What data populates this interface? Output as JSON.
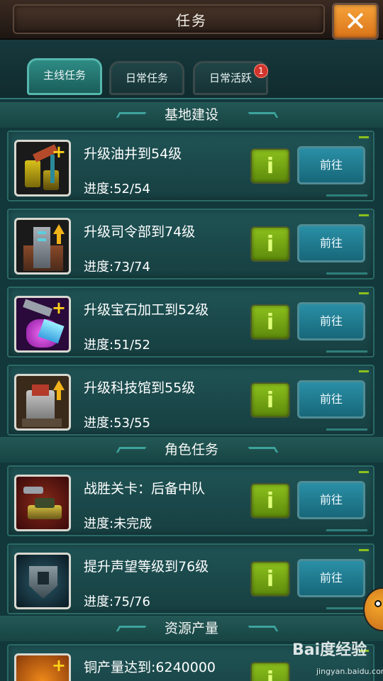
{
  "header": {
    "title": "任务",
    "close_label": "✕"
  },
  "tabs": [
    {
      "label": "主线任务",
      "active": true
    },
    {
      "label": "日常任务",
      "active": false
    },
    {
      "label": "日常活跃",
      "active": false,
      "badge": "1"
    }
  ],
  "sections": [
    {
      "title": "基地建设",
      "tasks": [
        {
          "title": "升级油井到54级",
          "progress": "进度:52/54",
          "icon": "oil-well-icon"
        },
        {
          "title": "升级司令部到74级",
          "progress": "进度:73/74",
          "icon": "headquarters-icon"
        },
        {
          "title": "升级宝石加工到52级",
          "progress": "进度:51/52",
          "icon": "gem-processing-icon"
        },
        {
          "title": "升级科技馆到55级",
          "progress": "进度:53/55",
          "icon": "tech-center-icon"
        }
      ]
    },
    {
      "title": "角色任务",
      "tasks": [
        {
          "title": "战胜关卡：后备中队",
          "progress": "进度:未完成",
          "icon": "tank-icon"
        },
        {
          "title": "提升声望等级到76级",
          "progress": "进度:75/76",
          "icon": "prestige-badge-icon"
        }
      ]
    },
    {
      "title": "资源产量",
      "tasks": [
        {
          "title": "铜产量达到:6240000",
          "progress": "",
          "icon": "copper-icon"
        }
      ]
    }
  ],
  "buttons": {
    "info_label": "i",
    "go_label": "前往"
  },
  "watermark": {
    "brand": "Bai度经验",
    "url": "jingyan.baidu.com"
  },
  "colors": {
    "accent_green": "#8cc01c",
    "go_blue": "#2a8fa6",
    "close_orange": "#f7a33a",
    "panel_teal": "#12383b"
  }
}
